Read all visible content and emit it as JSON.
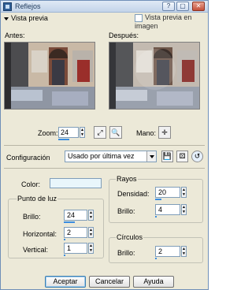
{
  "window": {
    "title": "Reflejos"
  },
  "preview_section": {
    "header": "Vista previa",
    "show_in_image_label": "Vista previa en imagen",
    "before_label": "Antes:",
    "after_label": "Después:"
  },
  "zoom": {
    "label": "Zoom:",
    "value": "24"
  },
  "pan": {
    "label": "Mano:"
  },
  "config": {
    "label": "Configuración",
    "selected": "Usado por última vez"
  },
  "color": {
    "label": "Color:",
    "value_hex": "#e9f6fb"
  },
  "light_point": {
    "title": "Punto de luz",
    "brillo_label": "Brillo:",
    "brillo_value": "24",
    "horizontal_label": "Horizontal:",
    "horizontal_value": "2",
    "vertical_label": "Vertical:",
    "vertical_value": "1"
  },
  "rays": {
    "title": "Rayos",
    "densidad_label": "Densidad:",
    "densidad_value": "20",
    "brillo_label": "Brillo:",
    "brillo_value": "4"
  },
  "circles": {
    "title": "Círculos",
    "brillo_label": "Brillo:",
    "brillo_value": "2"
  },
  "buttons": {
    "accept": "Aceptar",
    "cancel": "Cancelar",
    "help": "Ayuda"
  }
}
